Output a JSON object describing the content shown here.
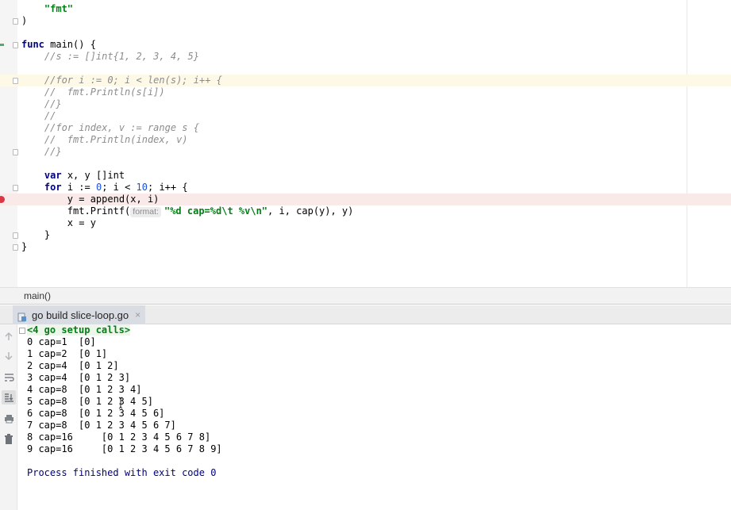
{
  "editor": {
    "lines": [
      {
        "segments": [
          {
            "t": "    "
          },
          {
            "t": "\"fmt\"",
            "c": "str"
          }
        ]
      },
      {
        "segments": [
          {
            "t": ")"
          }
        ]
      },
      {
        "segments": [
          {
            "t": ""
          }
        ]
      },
      {
        "segments": [
          {
            "t": "func",
            "c": "kw"
          },
          {
            "t": " main() {"
          }
        ]
      },
      {
        "segments": [
          {
            "t": "    "
          },
          {
            "t": "//s := []int{1, 2, 3, 4, 5}",
            "c": "cmt"
          }
        ]
      },
      {
        "segments": [
          {
            "t": ""
          }
        ]
      },
      {
        "segments": [
          {
            "t": "    "
          },
          {
            "t": "//for i := 0; i < len(s); i++ {",
            "c": "cmt"
          }
        ]
      },
      {
        "segments": [
          {
            "t": "    "
          },
          {
            "t": "//  fmt.Println(s[i])",
            "c": "cmt"
          }
        ]
      },
      {
        "segments": [
          {
            "t": "    "
          },
          {
            "t": "//}",
            "c": "cmt"
          }
        ]
      },
      {
        "segments": [
          {
            "t": "    "
          },
          {
            "t": "//",
            "c": "cmt"
          }
        ]
      },
      {
        "segments": [
          {
            "t": "    "
          },
          {
            "t": "//for index, v := range s {",
            "c": "cmt"
          }
        ]
      },
      {
        "segments": [
          {
            "t": "    "
          },
          {
            "t": "//  fmt.Println(index, v)",
            "c": "cmt"
          }
        ]
      },
      {
        "segments": [
          {
            "t": "    "
          },
          {
            "t": "//}",
            "c": "cmt"
          }
        ]
      },
      {
        "segments": [
          {
            "t": ""
          }
        ]
      },
      {
        "segments": [
          {
            "t": "    "
          },
          {
            "t": "var",
            "c": "kw"
          },
          {
            "t": " x, y []int"
          }
        ]
      },
      {
        "segments": [
          {
            "t": "    "
          },
          {
            "t": "for",
            "c": "kw"
          },
          {
            "t": " i := "
          },
          {
            "t": "0",
            "c": "num"
          },
          {
            "t": "; i < "
          },
          {
            "t": "10",
            "c": "num"
          },
          {
            "t": "; i++ {"
          }
        ]
      },
      {
        "segments": [
          {
            "t": "        y = append(x, i)"
          }
        ]
      },
      {
        "segments": [
          {
            "t": "        fmt.Printf("
          },
          {
            "t": "format:",
            "c": "hint"
          },
          {
            "t": "\"%d cap=%d\\t %v\\n\"",
            "c": "str"
          },
          {
            "t": ", i, cap(y), y)"
          }
        ]
      },
      {
        "segments": [
          {
            "t": "        x = y"
          }
        ]
      },
      {
        "segments": [
          {
            "t": "    }"
          }
        ]
      },
      {
        "segments": [
          {
            "t": "}"
          }
        ]
      }
    ]
  },
  "breadcrumb": {
    "label": "main()"
  },
  "run_panel": {
    "tab_label": "go build slice-loop.go",
    "tab_close": "×",
    "icons": [
      "arrow-up-icon",
      "arrow-down-icon",
      "soft-wrap-icon",
      "scroll-to-end-icon",
      "print-icon",
      "trash-icon"
    ],
    "output": [
      {
        "text": "<4 go setup calls>",
        "kind": "setup"
      },
      {
        "text": "0 cap=1  [0]"
      },
      {
        "text": "1 cap=2  [0 1]"
      },
      {
        "text": "2 cap=4  [0 1 2]"
      },
      {
        "text": "3 cap=4  [0 1 2 3]"
      },
      {
        "text": "4 cap=8  [0 1 2 3 4]"
      },
      {
        "text": "5 cap=8  [0 1 2 3 4 5]"
      },
      {
        "text": "6 cap=8  [0 1 2 3 4 5 6]"
      },
      {
        "text": "7 cap=8  [0 1 2 3 4 5 6 7]"
      },
      {
        "text": "8 cap=16     [0 1 2 3 4 5 6 7 8]"
      },
      {
        "text": "9 cap=16     [0 1 2 3 4 5 6 7 8 9]"
      },
      {
        "text": ""
      },
      {
        "text": "Process finished with exit code 0",
        "kind": "finish"
      }
    ]
  },
  "colors": {
    "keyword": "#000080",
    "string": "#067d17",
    "number": "#1750eb",
    "comment": "#8c8c8c",
    "breakpoint": "#dc3545",
    "highlight_yellow": "#fdf9e6",
    "highlight_red": "#fae9e9"
  }
}
